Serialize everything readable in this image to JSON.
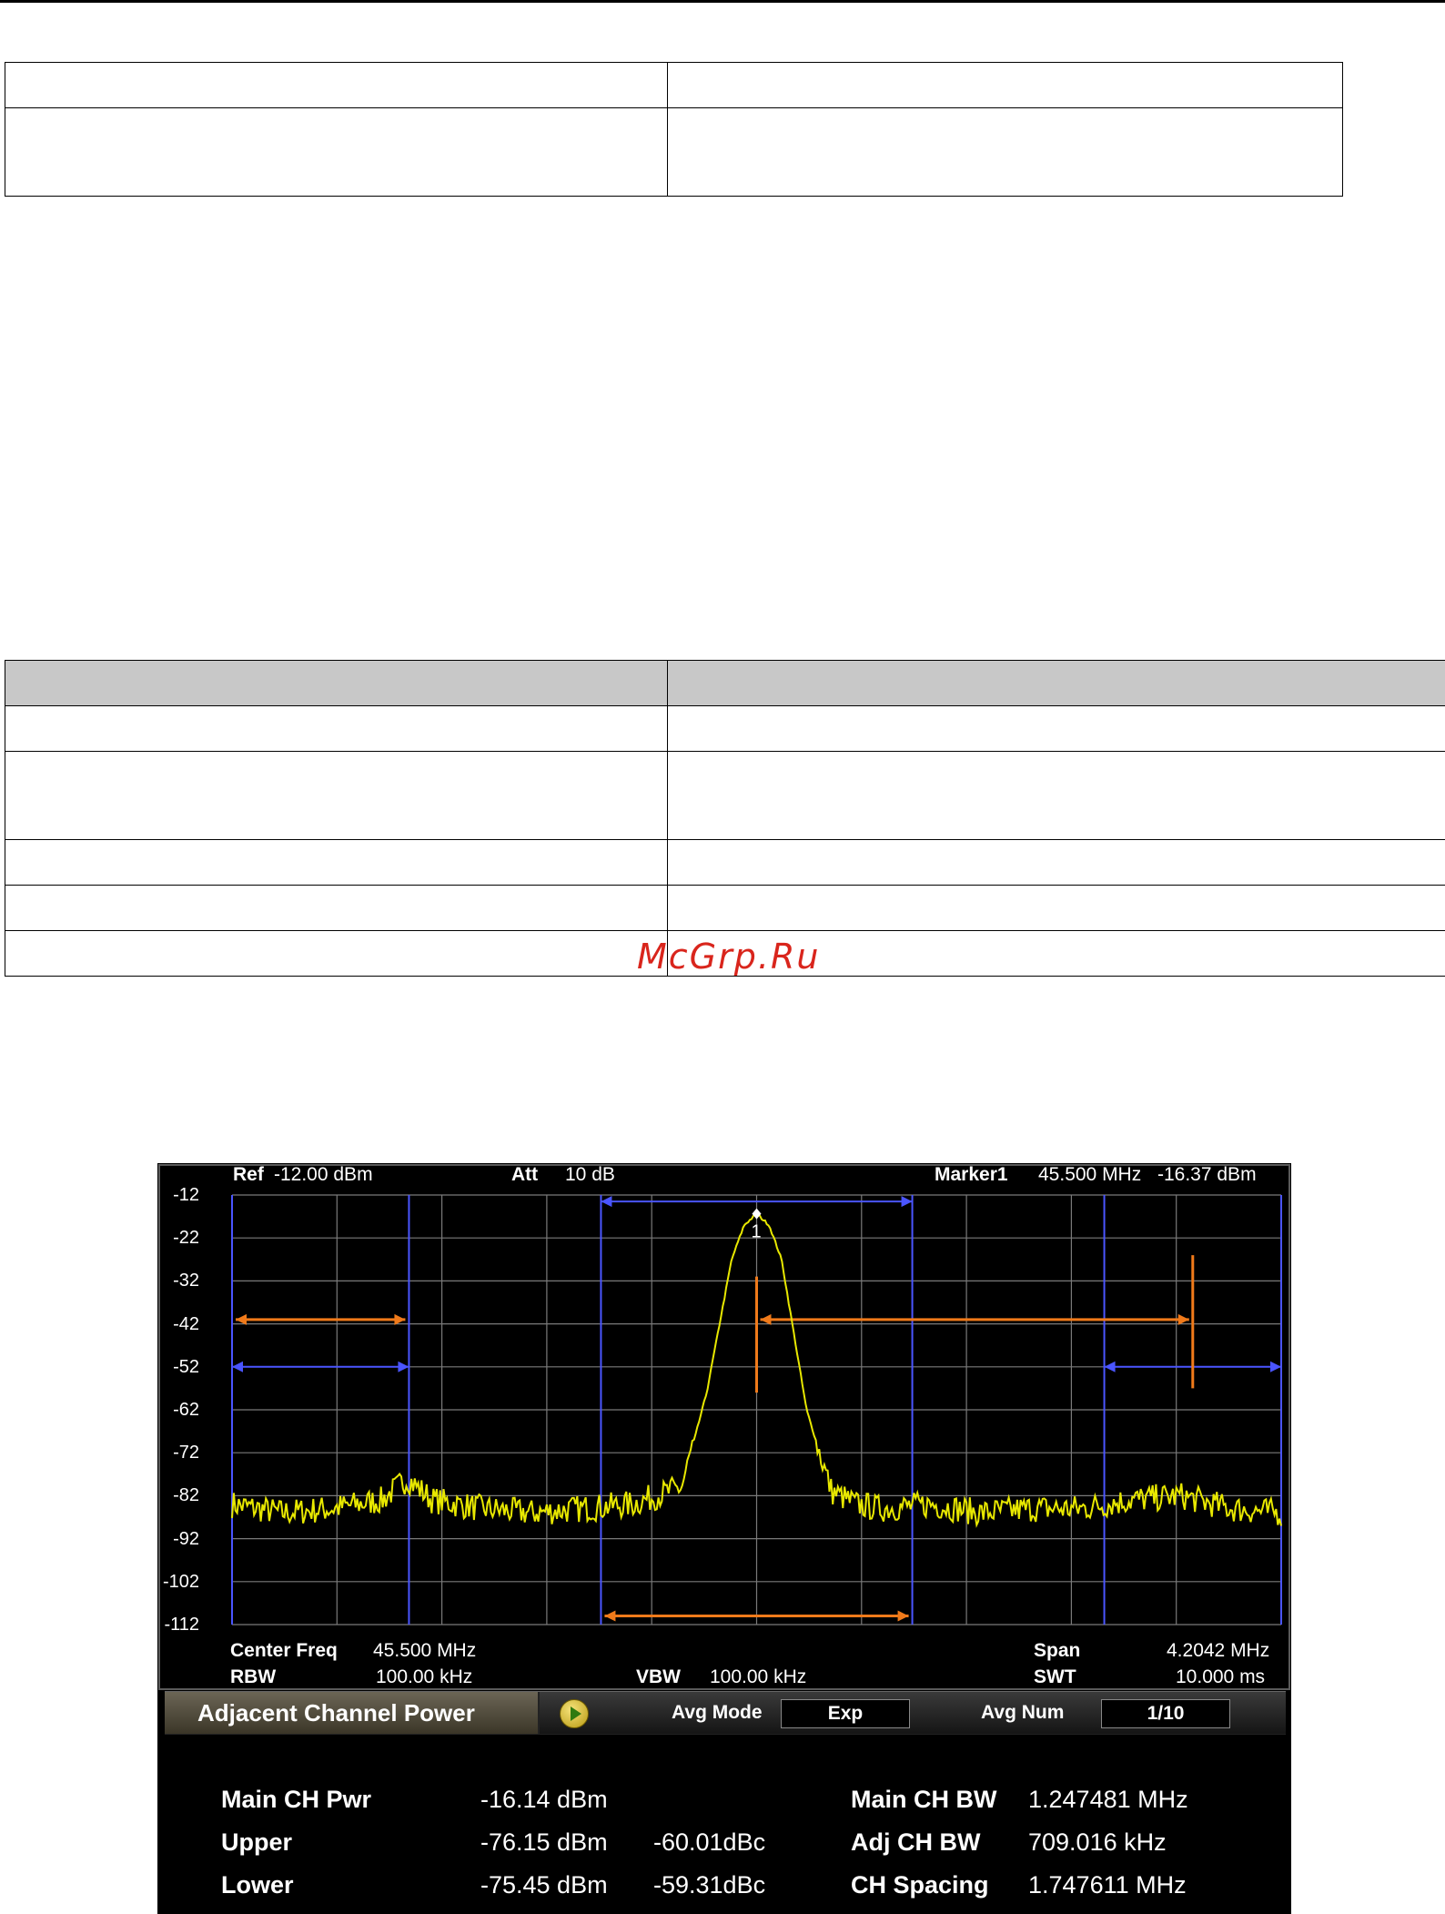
{
  "watermark": "McGrp.Ru",
  "screen": {
    "header": {
      "ref_label": "Ref",
      "ref_value": "-12.00 dBm",
      "att_label": "Att",
      "att_value": "10 dB",
      "marker_label": "Marker1",
      "marker_freq": "45.500 MHz",
      "marker_level": "-16.37 dBm",
      "marker_number": "1"
    },
    "y_ticks": [
      "-12",
      "-22",
      "-32",
      "-42",
      "-52",
      "-62",
      "-72",
      "-82",
      "-92",
      "-102",
      "-112"
    ],
    "footer": {
      "center_label": "Center Freq",
      "center_value": "45.500 MHz",
      "span_label": "Span",
      "span_value": "4.2042 MHz",
      "rbw_label": "RBW",
      "rbw_value": "100.00 kHz",
      "vbw_label": "VBW",
      "vbw_value": "100.00 kHz",
      "swt_label": "SWT",
      "swt_value": "10.000 ms"
    },
    "measure_bar": {
      "title": "Adjacent Channel Power",
      "avg_mode_label": "Avg Mode",
      "avg_mode_value": "Exp",
      "avg_num_label": "Avg Num",
      "avg_num_value": "1/10"
    },
    "results": {
      "main_label": "Main CH Pwr",
      "main_value": "-16.14 dBm",
      "upper_label": "Upper",
      "upper_value": "-76.15 dBm",
      "upper_dbc": "-60.01dBc",
      "lower_label": "Lower",
      "lower_value": "-75.45 dBm",
      "lower_dbc": "-59.31dBc",
      "main_bw_label": "Main CH BW",
      "main_bw_value": "1.247481 MHz",
      "adj_bw_label": "Adj CH BW",
      "adj_bw_value": "709.016 kHz",
      "spacing_label": "CH Spacing",
      "spacing_value": "1.747611 MHz"
    },
    "colors": {
      "trace": "#e8e800",
      "channel_lines": "#4a55ff",
      "annotations": "#f07a1a",
      "grid": "#7a7a7a"
    }
  },
  "chart_data": {
    "type": "line",
    "title": "",
    "xlabel": "",
    "ylabel": "",
    "xlim": [
      43.3979,
      47.6021
    ],
    "ylim": [
      -112,
      -12
    ],
    "grid": true,
    "x_unit": "MHz",
    "y_unit": "dBm",
    "series": [
      {
        "x": [
          43.4,
          43.6,
          43.8,
          44.0,
          44.1,
          44.2,
          44.4,
          44.6,
          44.8,
          45.0,
          45.1,
          45.2,
          45.3,
          45.4,
          45.45,
          45.5,
          45.55,
          45.6,
          45.7,
          45.8,
          45.9,
          46.0,
          46.2,
          46.4,
          46.6,
          46.8,
          47.0,
          47.2,
          47.4,
          47.6
        ],
        "values": [
          -84,
          -86,
          -85,
          -83,
          -78,
          -83,
          -85,
          -86,
          -85,
          -84,
          -82,
          -80,
          -58,
          -27,
          -19,
          -16.4,
          -19,
          -27,
          -62,
          -81,
          -84,
          -85,
          -84,
          -86,
          -85,
          -85,
          -83,
          -82,
          -85,
          -86
        ]
      }
    ],
    "marker": {
      "x": 45.5,
      "y": -16.37
    },
    "channels": {
      "main_bw_mhz": 1.247481,
      "adj_bw_khz": 709.016,
      "spacing_mhz": 1.747611
    }
  }
}
